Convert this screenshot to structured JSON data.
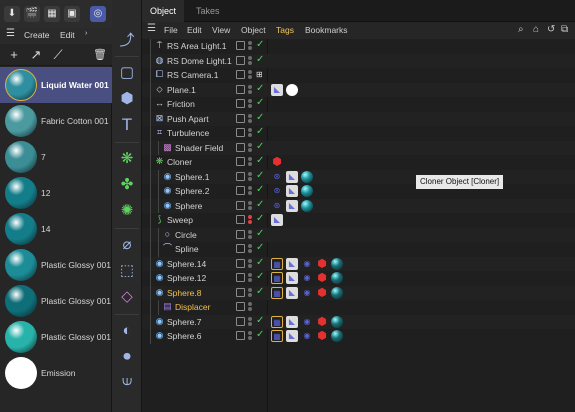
{
  "materials_panel": {
    "toolbar_icons": [
      "download-icon",
      "clapperboard-icon",
      "film-reel-icon",
      "camera-icon",
      "c4d-logo-icon"
    ],
    "menu": [
      "Create",
      "Edit"
    ],
    "materials": [
      {
        "name": "Liquid Water 001",
        "selected": true,
        "color": "#2e8fa0"
      },
      {
        "name": "Fabric Cotton 001",
        "selected": false,
        "color": "#4a9aa0"
      },
      {
        "name": "7",
        "selected": false,
        "color": "#3b8e96"
      },
      {
        "name": "12",
        "selected": false,
        "color": "#137e8a"
      },
      {
        "name": "14",
        "selected": false,
        "color": "#137e8a"
      },
      {
        "name": "Plastic Glossy 001",
        "selected": false,
        "color": "#1c8c97"
      },
      {
        "name": "Plastic Glossy 001",
        "selected": false,
        "color": "#0f6f79"
      },
      {
        "name": "Plastic Glossy 001",
        "selected": false,
        "color": "#27b3aa"
      },
      {
        "name": "Emission",
        "selected": false,
        "color": "#ffffff"
      }
    ]
  },
  "object_manager": {
    "tabs": [
      {
        "label": "Object",
        "active": true
      },
      {
        "label": "Takes",
        "active": false
      }
    ],
    "menu": [
      {
        "label": "File",
        "active": false
      },
      {
        "label": "Edit",
        "active": false
      },
      {
        "label": "View",
        "active": false
      },
      {
        "label": "Object",
        "active": false
      },
      {
        "label": "Tags",
        "active": true
      },
      {
        "label": "Bookmarks",
        "active": false
      }
    ],
    "objects": [
      {
        "name": "RS Area Light.1",
        "indent": 1,
        "icon": "area-light-icon",
        "check": "check"
      },
      {
        "name": "RS Dome Light.1",
        "indent": 1,
        "icon": "dome-light-icon",
        "check": "check"
      },
      {
        "name": "RS Camera.1",
        "indent": 1,
        "icon": "camera-icon",
        "check": "grid"
      },
      {
        "name": "Plane.1",
        "indent": 1,
        "icon": "plane-icon",
        "check": "check"
      },
      {
        "name": "Friction",
        "indent": 1,
        "icon": "friction-icon",
        "check": "check"
      },
      {
        "name": "Push Apart",
        "indent": 1,
        "icon": "push-apart-icon",
        "check": "check"
      },
      {
        "name": "Turbulence",
        "indent": 1,
        "icon": "turbulence-icon",
        "check": "check"
      },
      {
        "name": "Shader Field",
        "indent": 2,
        "icon": "shader-field-icon",
        "check": "check"
      },
      {
        "name": "Cloner",
        "indent": 1,
        "icon": "cloner-icon",
        "check": "check"
      },
      {
        "name": "Sphere.1",
        "indent": 2,
        "icon": "sphere-icon",
        "check": "check"
      },
      {
        "name": "Sphere.2",
        "indent": 2,
        "icon": "sphere-icon",
        "check": "check"
      },
      {
        "name": "Sphere",
        "indent": 2,
        "icon": "sphere-icon",
        "check": "check"
      },
      {
        "name": "Sweep",
        "indent": 1,
        "icon": "sweep-icon",
        "check": "check"
      },
      {
        "name": "Circle",
        "indent": 2,
        "icon": "circle-icon",
        "check": "check"
      },
      {
        "name": "Spline",
        "indent": 2,
        "icon": "spline-icon",
        "check": "check"
      },
      {
        "name": "Sphere.14",
        "indent": 1,
        "icon": "sphere-icon",
        "check": "check"
      },
      {
        "name": "Sphere.12",
        "indent": 1,
        "icon": "sphere-icon",
        "check": "check"
      },
      {
        "name": "Sphere.8",
        "indent": 1,
        "icon": "sphere-icon",
        "check": "check",
        "highlight": true
      },
      {
        "name": "Displacer",
        "indent": 2,
        "icon": "displacer-icon",
        "check": "none",
        "highlight": true
      },
      {
        "name": "Sphere.7",
        "indent": 1,
        "icon": "sphere-icon",
        "check": "check"
      },
      {
        "name": "Sphere.6",
        "indent": 1,
        "icon": "sphere-icon",
        "check": "check"
      }
    ]
  },
  "tooltip": "Cloner Object [Cloner]"
}
